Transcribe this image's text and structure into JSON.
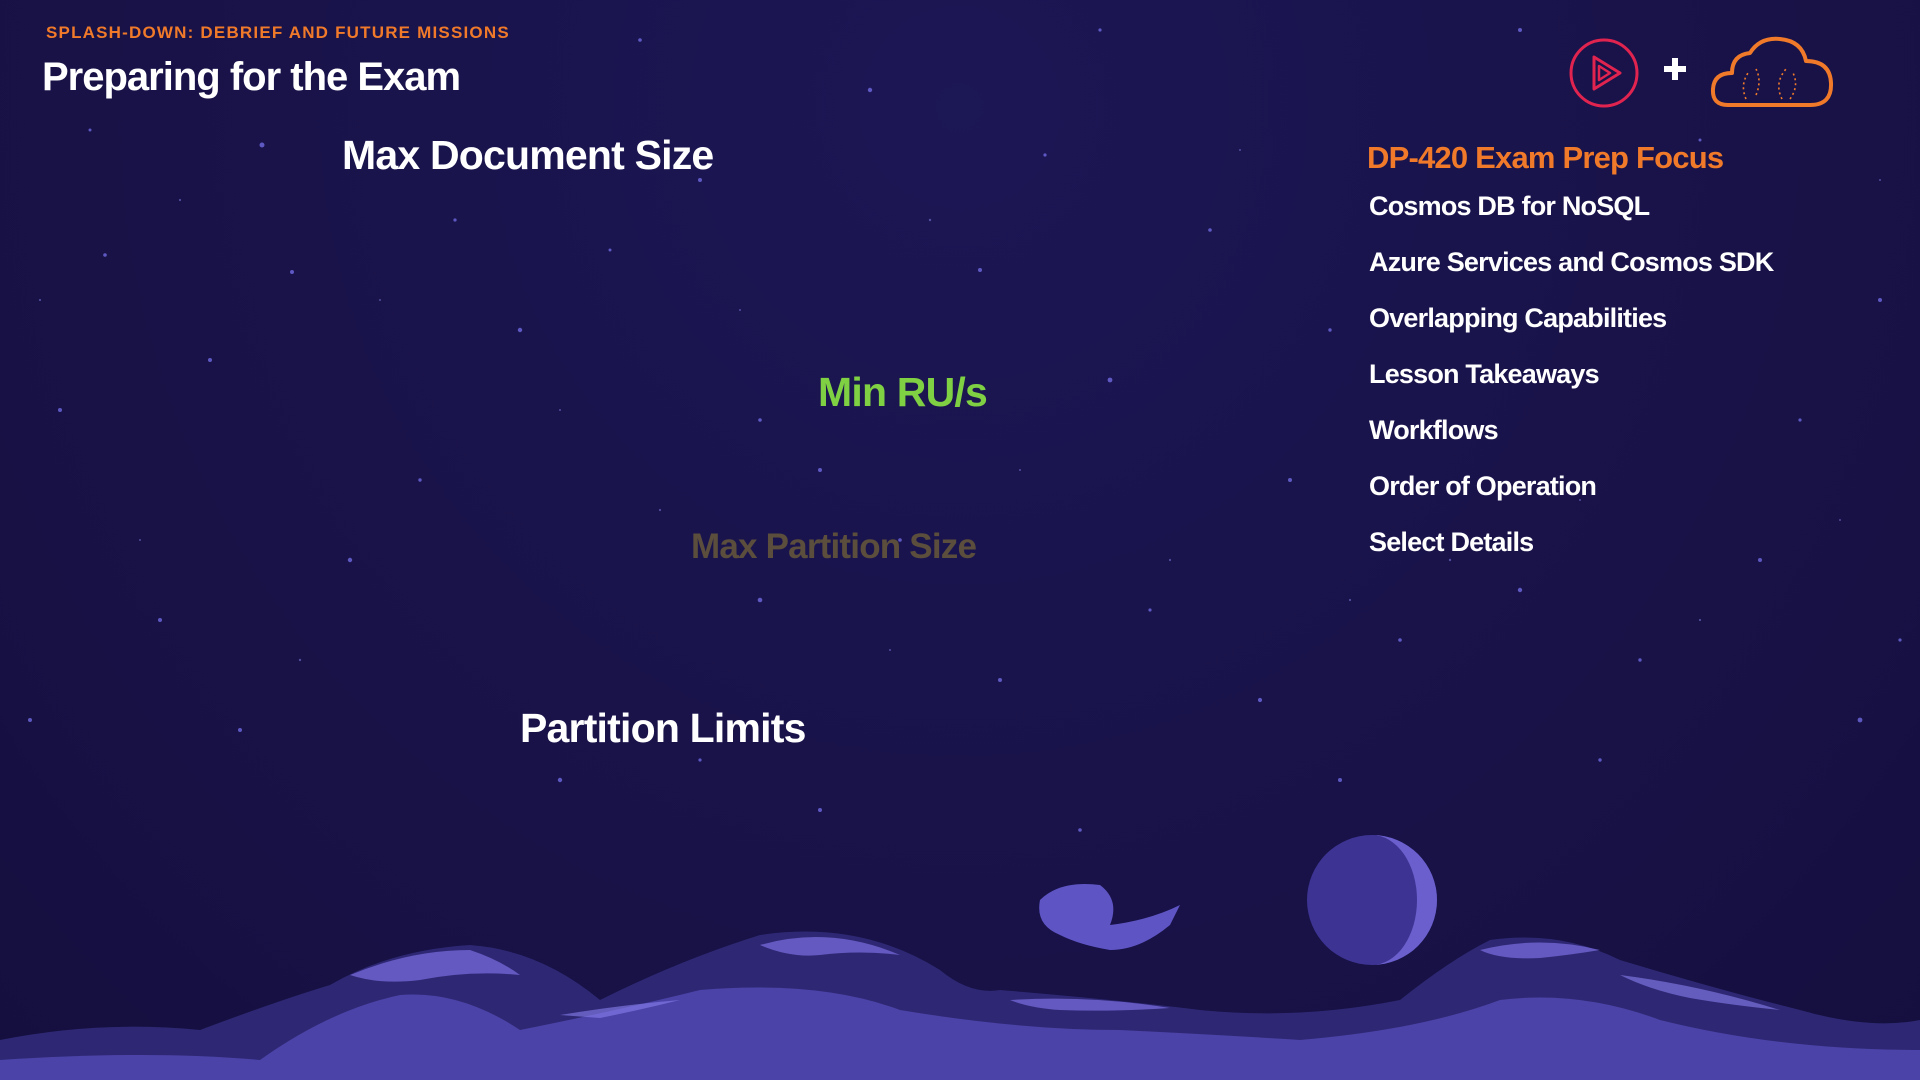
{
  "header": {
    "kicker": "SPLASH-DOWN: DEBRIEF AND FUTURE MISSIONS",
    "title": "Preparing for the Exam",
    "logos": {
      "left_icon": "play-icon",
      "plus_icon": "plus-icon",
      "right_icon": "cloud-icon"
    }
  },
  "floating_terms": [
    "Max Document Size",
    "Min RU/s",
    "Max Partition Size",
    "Partition Limits"
  ],
  "focus_panel": {
    "heading": "DP-420 Exam Prep Focus",
    "items": [
      "Cosmos DB for NoSQL",
      "Azure Services and Cosmos SDK",
      "Overlapping Capabilities",
      "Lesson Takeaways",
      "Workflows",
      "Order of Operation",
      "Select Details"
    ]
  },
  "colors": {
    "background": "#19134a",
    "accent_orange": "#f07a2a",
    "highlight_green": "#7fd143",
    "dim_brown": "#5b4e3c",
    "play_logo_red": "#e0244f",
    "landscape": "#5a4ec0"
  }
}
